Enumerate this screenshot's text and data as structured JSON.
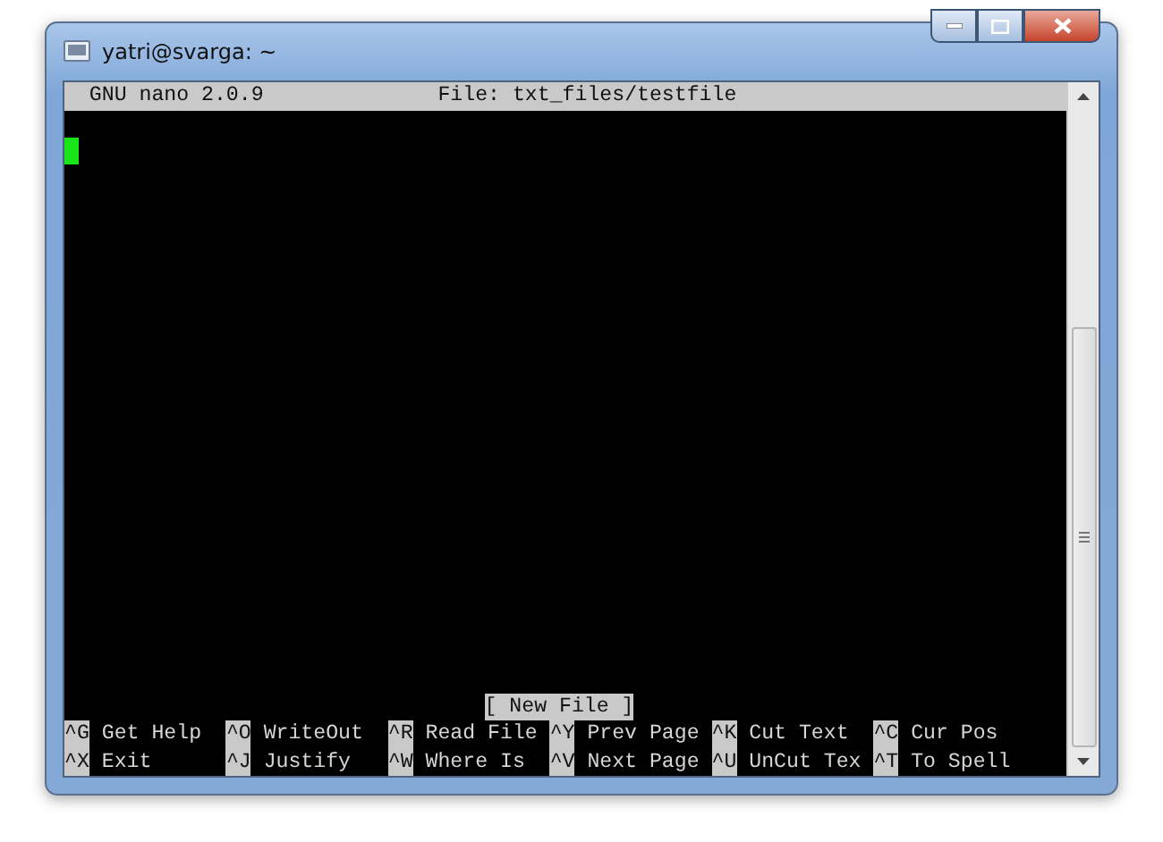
{
  "window": {
    "title": "yatri@svarga: ~"
  },
  "nano": {
    "header_left": "GNU nano 2.0.9",
    "header_center": "File: txt_files/testfile",
    "status": "[ New File ]",
    "shortcuts": [
      [
        {
          "key": "^G",
          "label": "Get Help"
        },
        {
          "key": "^O",
          "label": "WriteOut"
        },
        {
          "key": "^R",
          "label": "Read File"
        },
        {
          "key": "^Y",
          "label": "Prev Page"
        },
        {
          "key": "^K",
          "label": "Cut Text"
        },
        {
          "key": "^C",
          "label": "Cur Pos"
        }
      ],
      [
        {
          "key": "^X",
          "label": "Exit"
        },
        {
          "key": "^J",
          "label": "Justify"
        },
        {
          "key": "^W",
          "label": "Where Is"
        },
        {
          "key": "^V",
          "label": "Next Page"
        },
        {
          "key": "^U",
          "label": "UnCut Tex"
        },
        {
          "key": "^T",
          "label": "To Spell"
        }
      ]
    ]
  }
}
